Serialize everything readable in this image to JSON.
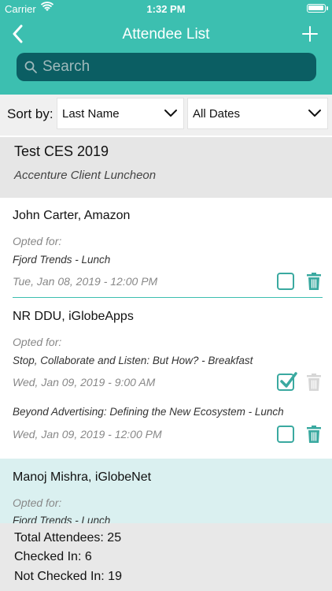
{
  "status_bar": {
    "carrier": "Carrier",
    "time": "1:32 PM"
  },
  "nav": {
    "title": "Attendee List"
  },
  "search": {
    "placeholder": "Search"
  },
  "sort": {
    "label": "Sort by:",
    "field": "Last Name",
    "dates": "All Dates"
  },
  "event": {
    "name": "Test CES 2019",
    "subtitle": "Accenture Client Luncheon"
  },
  "attendees": [
    {
      "name": "John Carter, Amazon",
      "opted_label": "Opted for:",
      "sessions": [
        {
          "title": "Fjord Trends - Lunch",
          "datetime": "Tue, Jan 08, 2019 - 12:00 PM",
          "checked": false
        }
      ]
    },
    {
      "name": "NR DDU, iGlobeApps",
      "opted_label": "Opted for:",
      "sessions": [
        {
          "title": "Stop, Collaborate and Listen: But How? - Breakfast",
          "datetime": "Wed, Jan 09, 2019 - 9:00 AM",
          "checked": true
        },
        {
          "title": "Beyond Advertising: Defining the New Ecosystem - Lunch",
          "datetime": "Wed, Jan 09, 2019 - 12:00 PM",
          "checked": false
        }
      ]
    },
    {
      "name": "Manoj Mishra, iGlobeNet",
      "opted_label": "Opted for:",
      "sessions": [
        {
          "title": "Fjord Trends - Lunch"
        }
      ]
    }
  ],
  "summary": {
    "total": "Total Attendees: 25",
    "checked_in": "Checked In: 6",
    "not_checked_in": "Not Checked In: 19"
  },
  "colors": {
    "accent": "#3cbfb0",
    "search_bg": "#0b5e63",
    "icon": "#3aa9a0"
  }
}
